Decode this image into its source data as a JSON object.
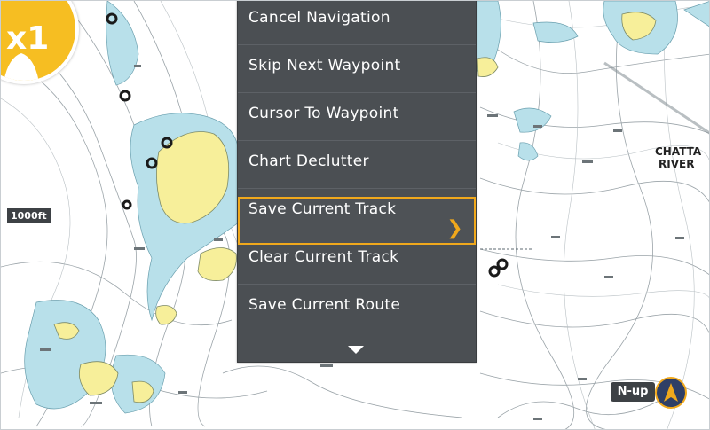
{
  "menu": {
    "items": [
      {
        "label": "Cancel Navigation"
      },
      {
        "label": "Skip Next Waypoint"
      },
      {
        "label": "Cursor To Waypoint"
      },
      {
        "label": "Chart Declutter"
      },
      {
        "label": "Save Current Track",
        "selected": true,
        "has_submenu": true
      },
      {
        "label": "Clear Current Track"
      },
      {
        "label": "Save Current Route"
      }
    ],
    "more_indicator": "down-arrow-icon",
    "submenu_icon": "chevron-right-icon"
  },
  "map": {
    "scale": "1000ft",
    "place_label_1": "CHATTA",
    "place_label_2": "RIVER",
    "orientation": "N-up",
    "zoom_level": "x1"
  },
  "colors": {
    "menu_bg": "#4b4f53",
    "accent": "#f0a81c",
    "shallow_water": "#b8e0ea",
    "land": "#f7ef9a"
  }
}
